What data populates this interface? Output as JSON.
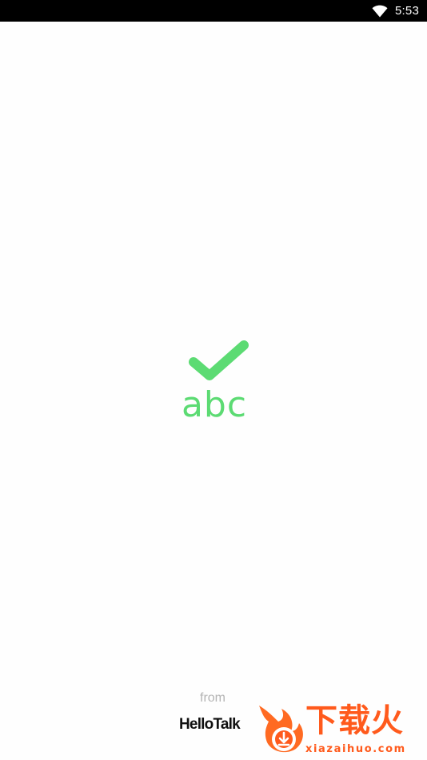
{
  "status_bar": {
    "wifi_icon": "wifi-icon",
    "time": "5:53"
  },
  "splash": {
    "logo_icon": "checkmark-icon",
    "logo_text": "abc",
    "from_label": "from",
    "brand": "HelloTalk"
  },
  "watermark": {
    "icon": "flame-download-icon",
    "title": "下载火",
    "url": "xiazaihuo.com"
  },
  "colors": {
    "accent_green": "#5cdb73",
    "watermark_orange": "#ff5a1c",
    "status_bar": "#000000",
    "background": "#fefefe"
  }
}
